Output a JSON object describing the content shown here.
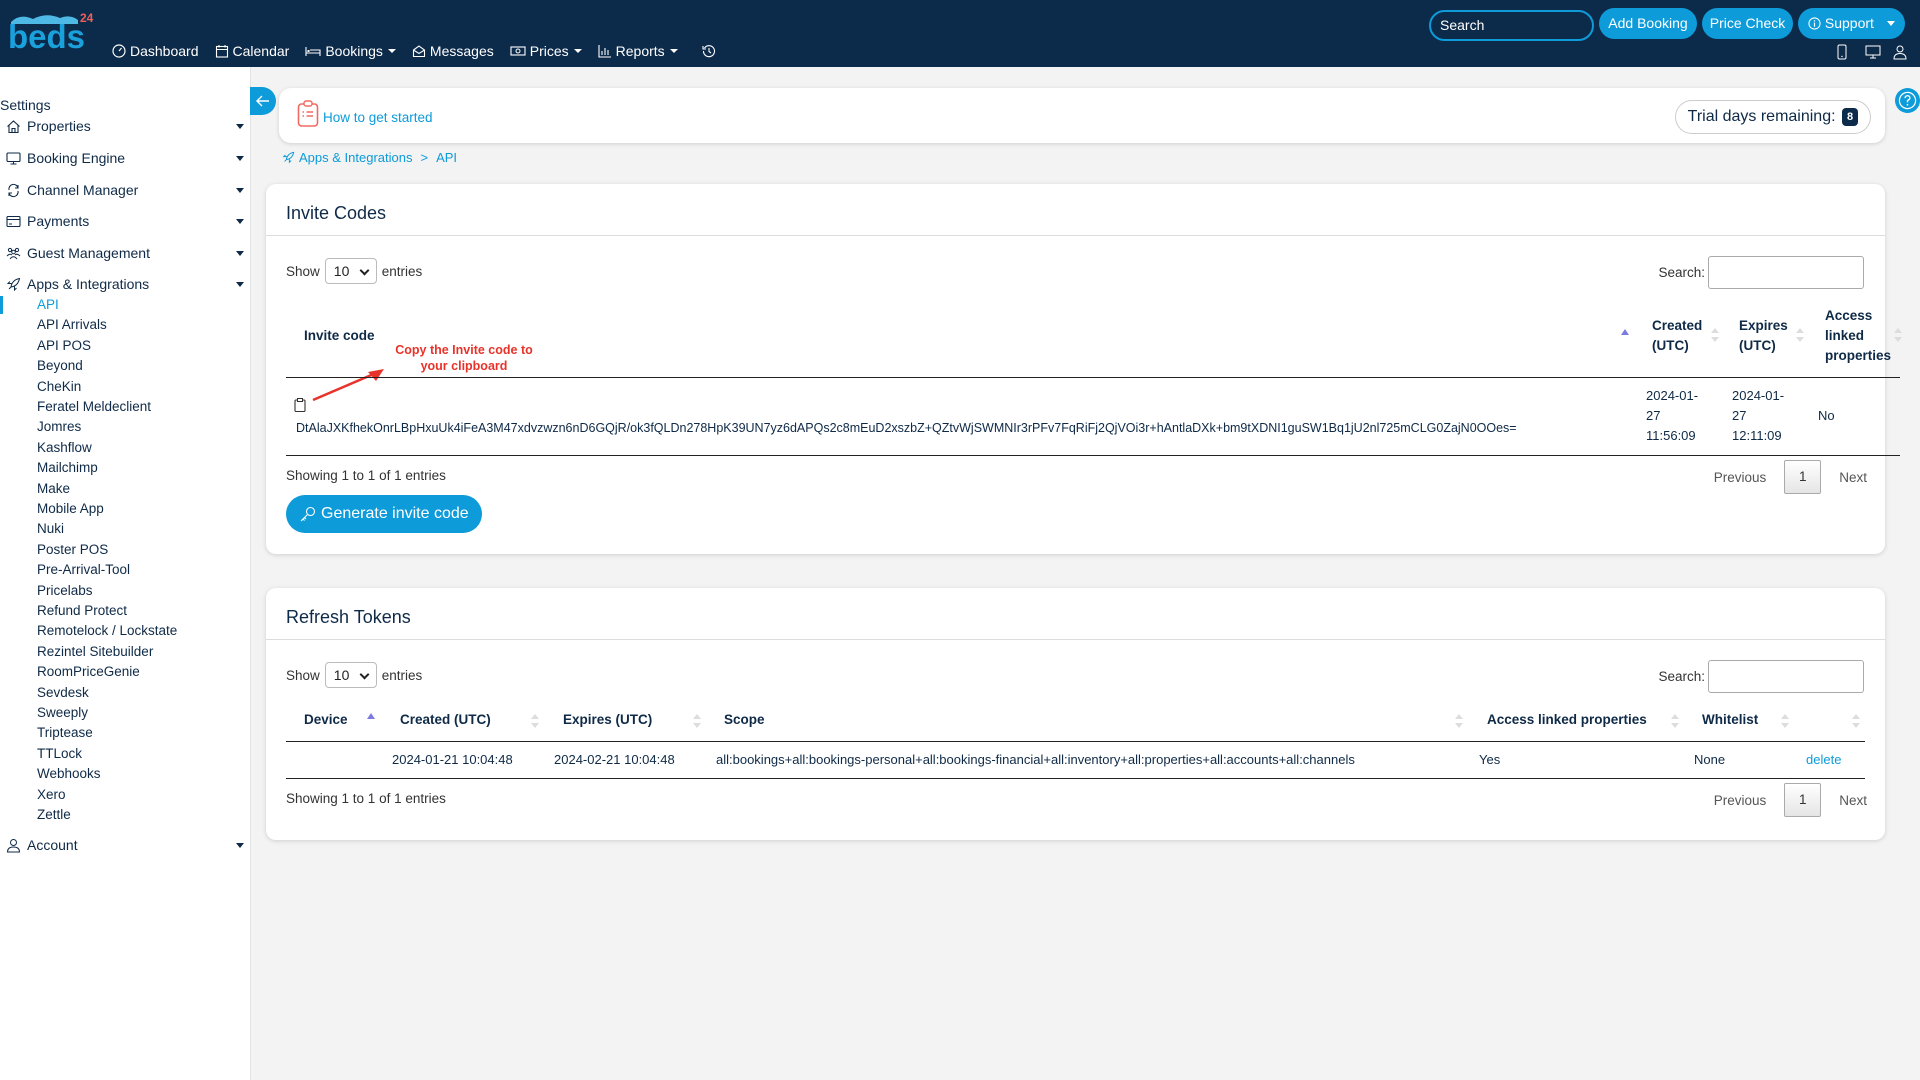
{
  "brand": {
    "logo_text": "beds",
    "logo_sup": "24"
  },
  "nav": [
    {
      "label": "Dashboard",
      "icon": "dashboard-icon",
      "dropdown": false
    },
    {
      "label": "Calendar",
      "icon": "calendar-icon",
      "dropdown": false
    },
    {
      "label": "Bookings",
      "icon": "bed-icon",
      "dropdown": true
    },
    {
      "label": "Messages",
      "icon": "messages-icon",
      "dropdown": false
    },
    {
      "label": "Prices",
      "icon": "money-icon",
      "dropdown": true
    },
    {
      "label": "Reports",
      "icon": "chart-icon",
      "dropdown": true
    }
  ],
  "header": {
    "search_placeholder": "Search",
    "add_booking": "Add Booking",
    "price_check": "Price Check",
    "support": "Support"
  },
  "sidebar": {
    "title": "Settings",
    "sections": [
      {
        "label": "Properties",
        "icon": "home-icon"
      },
      {
        "label": "Booking Engine",
        "icon": "monitor-icon"
      },
      {
        "label": "Channel Manager",
        "icon": "sync-icon"
      },
      {
        "label": "Payments",
        "icon": "card-icon"
      },
      {
        "label": "Guest Management",
        "icon": "users-icon"
      },
      {
        "label": "Apps & Integrations",
        "icon": "rocket-icon"
      }
    ],
    "apps_items": [
      "API",
      "API Arrivals",
      "API POS",
      "Beyond",
      "CheKin",
      "Feratel Meldeclient",
      "Jomres",
      "Kashflow",
      "Mailchimp",
      "Make",
      "Mobile App",
      "Nuki",
      "Poster POS",
      "Pre-Arrival-Tool",
      "Pricelabs",
      "Refund Protect",
      "Remotelock / Lockstate",
      "Rezintel Sitebuilder",
      "RoomPriceGenie",
      "Sevdesk",
      "Sweeply",
      "Triptease",
      "TTLock",
      "Webhooks",
      "Xero",
      "Zettle"
    ],
    "active_item": "API",
    "account": "Account"
  },
  "guide": {
    "link": "How to get started",
    "trial_label": "Trial days remaining:",
    "trial_days": "8"
  },
  "breadcrumb": {
    "parent": "Apps & Integrations",
    "sep": ">",
    "current": "API"
  },
  "invite_codes": {
    "title": "Invite Codes",
    "show_label": "Show",
    "entries_label": "entries",
    "page_size": "10",
    "search_label": "Search:",
    "columns": [
      "Invite code",
      "Created (UTC)",
      "Expires (UTC)",
      "Access linked properties"
    ],
    "rows": [
      {
        "code": "DtAlaJXKfhekOnrLBpHxuUk4iFeA3M47xdvzwzn6nD6GQjR/ok3fQLDn278HpK39UN7yz6dAPQs2c8mEuD2xszbZ+QZtvWjSWMNIr3rPFv7FqRiFj2QjVOi3r+hAntlaDXk+bm9tXDNI1guSW1Bq1jU2nl725mCLG0ZajN0OOes=",
        "created": [
          "2024-01-",
          "27",
          "11:56:09"
        ],
        "expires": [
          "2024-01-",
          "27",
          "12:11:09"
        ],
        "access_linked": "No"
      }
    ],
    "annotation": "Copy the Invite code to your clipboard",
    "info": "Showing 1 to 1 of 1 entries",
    "prev": "Previous",
    "page": "1",
    "next": "Next",
    "generate": "Generate invite code"
  },
  "refresh_tokens": {
    "title": "Refresh Tokens",
    "show_label": "Show",
    "entries_label": "entries",
    "page_size": "10",
    "search_label": "Search:",
    "columns": [
      "Device",
      "Created (UTC)",
      "Expires (UTC)",
      "Scope",
      "Access linked properties",
      "Whitelist"
    ],
    "rows": [
      {
        "device": "",
        "created": "2024-01-21 10:04:48",
        "expires": "2024-02-21 10:04:48",
        "scope": "all:bookings+all:bookings-personal+all:bookings-financial+all:inventory+all:properties+all:accounts+all:channels",
        "access_linked": "Yes",
        "whitelist": "None",
        "action": "delete"
      }
    ],
    "info": "Showing 1 to 1 of 1 entries",
    "prev": "Previous",
    "page": "1",
    "next": "Next"
  },
  "colors": {
    "navy": "#0c2a4a",
    "accent": "#0d9bd9",
    "annotation": "#e8332a"
  }
}
